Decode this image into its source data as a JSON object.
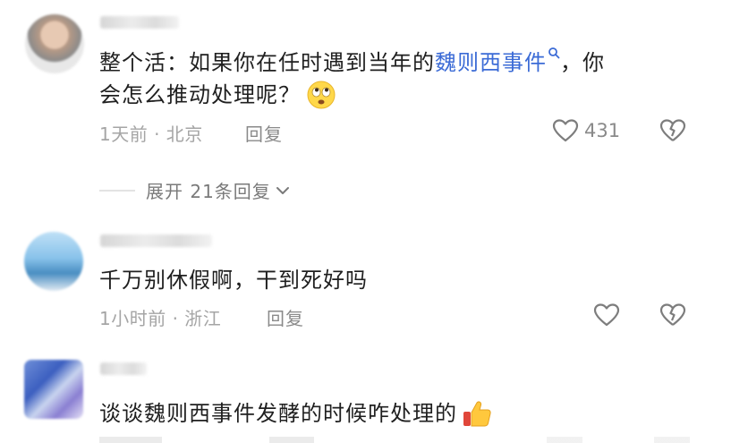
{
  "comments": [
    {
      "text_before": "整个活：如果你在任时遇到当年的",
      "link_text": "魏则西事件",
      "text_after_line1": "，你",
      "line2": "会怎么推动处理呢？",
      "meta": "1天前 · 北京",
      "reply_label": "回复",
      "likes": "431",
      "emoji": "rolling-eyes-emoji"
    },
    {
      "expand_label": "展开 21条回复"
    },
    {
      "text": "千万别休假啊，干到死好吗",
      "meta": "1小时前 · 浙江",
      "reply_label": "回复"
    },
    {
      "text": "谈谈魏则西事件发酵的时候咋处理的",
      "emoji": "thumbs-up-emoji"
    }
  ],
  "colors": {
    "link": "#3b6bd6",
    "meta": "#a5a5a5",
    "icon": "#8a8a8a"
  }
}
